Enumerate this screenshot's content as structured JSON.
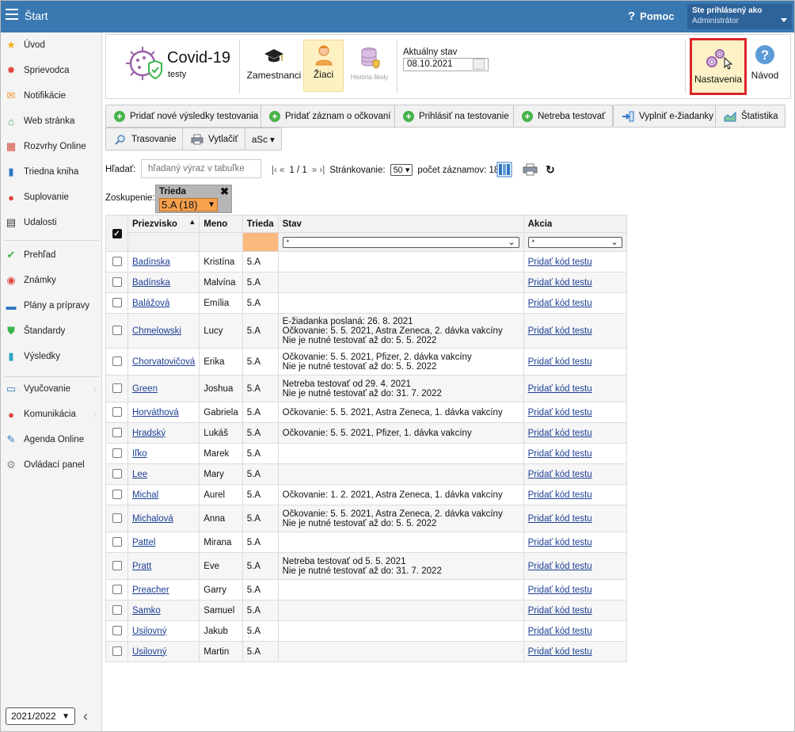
{
  "topbar": {
    "title": "Štart",
    "help_label": "Pomoc",
    "user_line1": "Ste prihlásený ako",
    "user_line2": "Administrátor"
  },
  "sidebar": {
    "items": [
      {
        "label": "Úvod",
        "icon": "star-icon",
        "color": "#f2b21d"
      },
      {
        "label": "Sprievodca",
        "icon": "runner-icon",
        "color": "#e0453a"
      },
      {
        "label": "Notifikácie",
        "icon": "envelope-icon",
        "color": "#f09a2b"
      },
      {
        "label": "Web stránka",
        "icon": "house-icon",
        "color": "#2e9a52"
      },
      {
        "label": "Rozvrhy Online",
        "icon": "timetable-icon",
        "color": "#d8473c"
      },
      {
        "label": "Triedna kniha",
        "icon": "book-icon",
        "color": "#2f78c4"
      },
      {
        "label": "Suplovanie",
        "icon": "person-icon",
        "color": "#e0453a"
      },
      {
        "label": "Udalosti",
        "icon": "calendar-icon",
        "color": "#333333"
      },
      {
        "label": "Prehľad",
        "icon": "check-circle-icon",
        "color": "#3cb54a"
      },
      {
        "label": "Známky",
        "icon": "grade-icon",
        "color": "#e0453a"
      },
      {
        "label": "Plány a prípravy",
        "icon": "briefcase-icon",
        "color": "#2f78c4"
      },
      {
        "label": "Štandardy",
        "icon": "shield-icon",
        "color": "#3cb54a"
      },
      {
        "label": "Výsledky",
        "icon": "bar-chart-icon",
        "color": "#2fa1c4"
      },
      {
        "label": "Vyučovanie",
        "icon": "book-open-icon",
        "color": "#2f78c4"
      },
      {
        "label": "Komunikácia",
        "icon": "chat-icon",
        "color": "#e0453a"
      },
      {
        "label": "Agenda Online",
        "icon": "pen-icon",
        "color": "#2f78c4"
      },
      {
        "label": "Ovládací panel",
        "icon": "gear-icon",
        "color": "#888888"
      }
    ],
    "year": "2021/2022"
  },
  "module": {
    "title": "Covid-19",
    "subtitle": "testy",
    "tabs": {
      "zamestnanci": "Zamestnanci",
      "ziaci": "Žiaci",
      "historia": "História školy"
    },
    "state_label": "Aktuálny stav",
    "state_date": "08.10.2021",
    "settings": "Nastavenia",
    "guide": "Návod"
  },
  "toolbar": {
    "add_results": "Pridať nové výsledky testovania",
    "add_vaccination": "Pridať záznam o očkovaní",
    "register_testing": "Prihlásiť na testovanie",
    "no_testing": "Netreba testovať",
    "fill_request": "Vyplniť e-žiadanky",
    "statistics": "Štatistika",
    "tracing": "Trasovanie",
    "print": "Vytlačiť",
    "asc": "aSc ▾"
  },
  "search": {
    "label": "Hľadať:",
    "placeholder": "hľadaný výraz v tabuľke"
  },
  "pager": {
    "nav_left": "|‹ « ",
    "page": "1 / 1",
    "nav_right": " » ›|",
    "paging_label": "Stránkovanie:",
    "page_size": "50",
    "count_label": "počet záznamov: 18"
  },
  "grouping": {
    "label": "Zoskupenie:",
    "field": "Trieda",
    "value": "5.A (18)"
  },
  "table": {
    "headers": [
      "Priezvisko",
      "Meno",
      "Trieda",
      "Stav",
      "Akcia"
    ],
    "filter_placeholder": "*",
    "rows": [
      {
        "last": "Badínska",
        "first": "Kristína",
        "class": "5.A",
        "status": [],
        "action": "Pridať kód testu"
      },
      {
        "last": "Badínska",
        "first": "Malvína",
        "class": "5.A",
        "status": [],
        "action": "Pridať kód testu"
      },
      {
        "last": "Balážová",
        "first": "Emília",
        "class": "5.A",
        "status": [],
        "action": "Pridať kód testu"
      },
      {
        "last": "Chmelowski",
        "first": "Lucy",
        "class": "5.A",
        "status": [
          "E-žiadanka poslaná: 26. 8. 2021",
          "Očkovanie: 5. 5. 2021, Astra Zeneca, 2. dávka vakcíny",
          "Nie je nutné testovať až do: 5. 5. 2022"
        ],
        "action": "Pridať kód testu"
      },
      {
        "last": "Chorvatovičová",
        "first": "Erika",
        "class": "5.A",
        "status": [
          "Očkovanie: 5. 5. 2021, Pfizer, 2. dávka vakcíny",
          "Nie je nutné testovať až do: 5. 5. 2022"
        ],
        "action": "Pridať kód testu"
      },
      {
        "last": "Green",
        "first": "Joshua",
        "class": "5.A",
        "status": [
          "Netreba testovať od 29. 4. 2021",
          "Nie je nutné testovať až do: 31. 7. 2022"
        ],
        "action": "Pridať kód testu"
      },
      {
        "last": "Horváthová",
        "first": "Gabriela",
        "class": "5.A",
        "status": [
          "Očkovanie: 5. 5. 2021, Astra Zeneca, 1. dávka vakcíny"
        ],
        "action": "Pridať kód testu"
      },
      {
        "last": "Hradský",
        "first": "Lukáš",
        "class": "5.A",
        "status": [
          "Očkovanie: 5. 5. 2021, Pfizer, 1. dávka vakcíny"
        ],
        "action": "Pridať kód testu"
      },
      {
        "last": "Iľko",
        "first": "Marek",
        "class": "5.A",
        "status": [],
        "action": "Pridať kód testu"
      },
      {
        "last": "Lee",
        "first": "Mary",
        "class": "5.A",
        "status": [],
        "action": "Pridať kód testu"
      },
      {
        "last": "Michal",
        "first": "Aurel",
        "class": "5.A",
        "status": [
          "Očkovanie: 1. 2. 2021, Astra Zeneca, 1. dávka vakcíny"
        ],
        "action": "Pridať kód testu"
      },
      {
        "last": "Michalová",
        "first": "Anna",
        "class": "5.A",
        "status": [
          "Očkovanie: 5. 5. 2021, Astra Zeneca, 2. dávka vakcíny",
          "Nie je nutné testovať až do: 5. 5. 2022"
        ],
        "action": "Pridať kód testu"
      },
      {
        "last": "Pattel",
        "first": "Mirana",
        "class": "5.A",
        "status": [],
        "action": "Pridať kód testu"
      },
      {
        "last": "Pratt",
        "first": "Eve",
        "class": "5.A",
        "status": [
          "Netreba testovať od 5. 5. 2021",
          "Nie je nutné testovať až do: 31. 7. 2022"
        ],
        "action": "Pridať kód testu"
      },
      {
        "last": "Preacher",
        "first": "Garry",
        "class": "5.A",
        "status": [],
        "action": "Pridať kód testu"
      },
      {
        "last": "Samko",
        "first": "Samuel",
        "class": "5.A",
        "status": [],
        "action": "Pridať kód testu"
      },
      {
        "last": "Usilovný",
        "first": "Jakub",
        "class": "5.A",
        "status": [],
        "action": "Pridať kód testu"
      },
      {
        "last": "Usilovný",
        "first": "Martin",
        "class": "5.A",
        "status": [],
        "action": "Pridať kód testu"
      }
    ]
  },
  "colors": {
    "topbar": "#3a78b1",
    "highlight_border": "#d9252a",
    "link": "#1c3f94",
    "group_value": "#f7a14f"
  }
}
